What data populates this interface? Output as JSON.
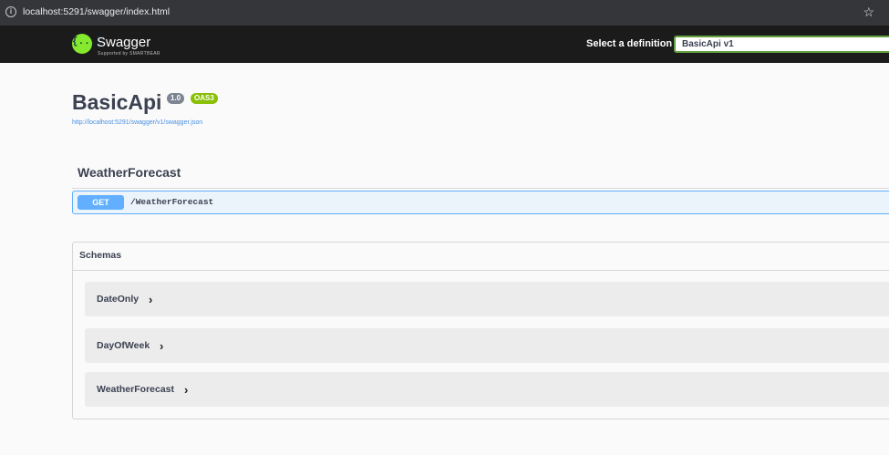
{
  "browser": {
    "url": "localhost:5291/swagger/index.html",
    "info_icon": "info-circle-icon",
    "star_icon": "star-icon"
  },
  "header": {
    "brand": "Swagger",
    "brand_sub": "Supported by SMARTBEAR",
    "logo_glyph": "{...}",
    "select_label": "Select a definition",
    "select_value": "BasicApi v1"
  },
  "info": {
    "title": "BasicApi",
    "version": "1.0",
    "oas": "OAS3",
    "spec_url": "http://localhost:5291/swagger/v1/swagger.json"
  },
  "tag": {
    "name": "WeatherForecast",
    "operations": [
      {
        "method": "GET",
        "path": "/WeatherForecast"
      }
    ]
  },
  "schemas": {
    "title": "Schemas",
    "items": [
      "DateOnly",
      "DayOfWeek",
      "WeatherForecast"
    ],
    "chevron": "›"
  },
  "colors": {
    "get": "#61affe",
    "swagger_green": "#85ea2d",
    "oas_badge": "#89bf04",
    "version_badge": "#7d8492"
  }
}
